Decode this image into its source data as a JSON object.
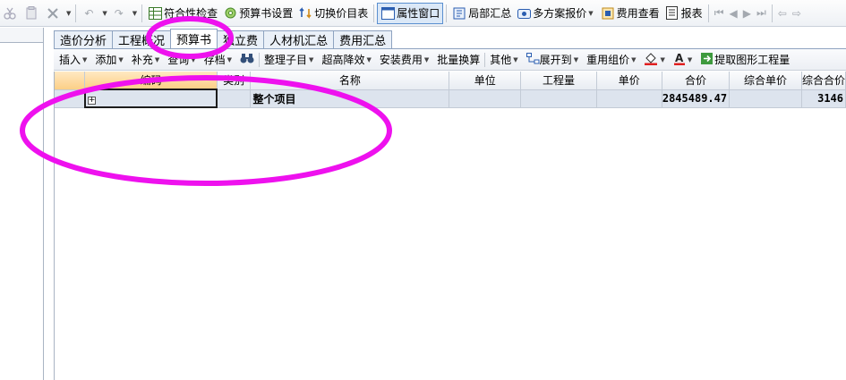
{
  "toolbar": {
    "compliance_check": "符合性检查",
    "budget_settings": "预算书设置",
    "switch_price_list": "切换价目表",
    "property_window": "属性窗口",
    "partial_summary": "局部汇总",
    "multi_scheme_quote": "多方案报价",
    "fee_view": "费用查看",
    "report": "报表"
  },
  "tabs": [
    {
      "label": "造价分析"
    },
    {
      "label": "工程概况"
    },
    {
      "label": "预算书"
    },
    {
      "label": "独立费"
    },
    {
      "label": "人材机汇总"
    },
    {
      "label": "费用汇总"
    }
  ],
  "subbar": {
    "insert": "插入",
    "add": "添加",
    "supplement": "补充",
    "query": "查询",
    "archive": "存档",
    "organize": "整理子目",
    "over_height": "超高降效",
    "install_fee": "安装费用",
    "batch_convert": "批量换算",
    "other": "其他",
    "expand_to": "展开到",
    "reuse_price": "重用组价",
    "extract_quantity": "提取图形工程量"
  },
  "grid": {
    "columns": [
      "编码",
      "类别",
      "名称",
      "单位",
      "工程量",
      "单价",
      "合价",
      "综合单价",
      "综合合价"
    ],
    "rows": [
      {
        "code": "",
        "type": "",
        "name": "整个项目",
        "unit": "",
        "quantity": "",
        "unit_price": "",
        "total": "2845489.47",
        "comp_unit_price": "",
        "comp_total": "3146"
      }
    ]
  },
  "colors": {
    "annotation": "#ee11ee",
    "header_highlight": "#fccf86",
    "row_bg": "#dde4ee"
  }
}
